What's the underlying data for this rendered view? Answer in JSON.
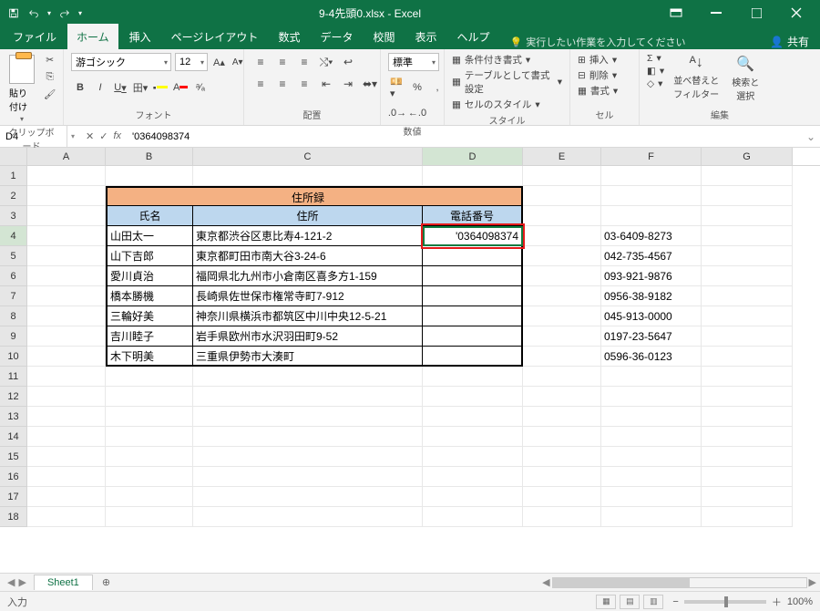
{
  "title": "9-4先頭0.xlsx - Excel",
  "qat": {
    "save": "save",
    "undo": "undo",
    "redo": "redo"
  },
  "tabs": [
    "ファイル",
    "ホーム",
    "挿入",
    "ページレイアウト",
    "数式",
    "データ",
    "校閲",
    "表示",
    "ヘルプ"
  ],
  "activeTab": "ホーム",
  "tellme": "実行したい作業を入力してください",
  "share": "共有",
  "ribbon": {
    "clipboard": {
      "paste": "貼り付け",
      "label": "クリップボード"
    },
    "font": {
      "name": "游ゴシック",
      "size": "12",
      "label": "フォント",
      "bold": "B",
      "italic": "I",
      "underline": "U",
      "border": "田",
      "fill": "🪣",
      "color": "A"
    },
    "alignment": {
      "label": "配置"
    },
    "number": {
      "format": "標準",
      "label": "数値"
    },
    "styles": {
      "cond": "条件付き書式",
      "table": "テーブルとして書式設定",
      "cell": "セルのスタイル",
      "label": "スタイル"
    },
    "cells": {
      "insert": "挿入",
      "delete": "削除",
      "format": "書式",
      "label": "セル"
    },
    "editing": {
      "sort": "並べ替えと\nフィルター",
      "find": "検索と\n選択",
      "label": "編集"
    }
  },
  "namebox": "D4",
  "formula": "'0364098374",
  "columns": [
    "A",
    "B",
    "C",
    "D",
    "E",
    "F",
    "G"
  ],
  "rowCount": 18,
  "table": {
    "title": "住所録",
    "headers": [
      "氏名",
      "住所",
      "電話番号"
    ],
    "rows": [
      {
        "name": "山田太一",
        "addr": "東京都渋谷区恵比寿4-121-2",
        "phone": "'0364098374",
        "alt": "03-6409-8273"
      },
      {
        "name": "山下吉郎",
        "addr": "東京都町田市南大谷3-24-6",
        "phone": "",
        "alt": "042-735-4567"
      },
      {
        "name": "愛川貞治",
        "addr": "福岡県北九州市小倉南区喜多方1-159",
        "phone": "",
        "alt": "093-921-9876"
      },
      {
        "name": "橋本勝機",
        "addr": "長崎県佐世保市権常寺町7-912",
        "phone": "",
        "alt": "0956-38-9182"
      },
      {
        "name": "三輪好美",
        "addr": "神奈川県横浜市都筑区中川中央12-5-21",
        "phone": "",
        "alt": "045-913-0000"
      },
      {
        "name": "吉川睦子",
        "addr": "岩手県欧州市水沢羽田町9-52",
        "phone": "",
        "alt": "0197-23-5647"
      },
      {
        "name": "木下明美",
        "addr": "三重県伊勢市大湊町",
        "phone": "",
        "alt": "0596-36-0123"
      }
    ]
  },
  "sheetTab": "Sheet1",
  "status": {
    "mode": "入力",
    "zoom": "100%"
  }
}
